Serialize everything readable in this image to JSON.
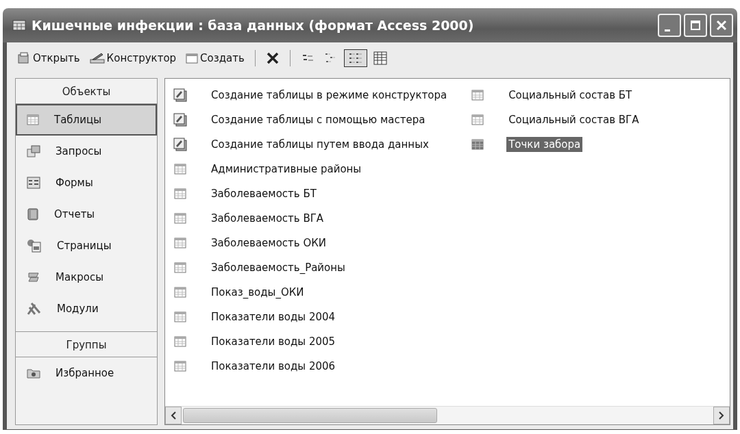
{
  "window": {
    "title": "Кишечные инфекции : база данных (формат Access 2000)"
  },
  "toolbar": [
    {
      "kind": "open",
      "label": "Открыть"
    },
    {
      "kind": "design",
      "label": "Конструктор"
    },
    {
      "kind": "new",
      "label": "Создать"
    },
    {
      "kind": "separator"
    },
    {
      "kind": "delete"
    },
    {
      "kind": "separator"
    },
    {
      "kind": "large-icons",
      "selected": false
    },
    {
      "kind": "small-icons",
      "selected": false
    },
    {
      "kind": "list",
      "selected": true
    },
    {
      "kind": "details",
      "selected": false
    }
  ],
  "sidebar": [
    {
      "header": "Объекты",
      "items": [
        {
          "kind": "table",
          "label": "Таблицы",
          "selected": true
        },
        {
          "kind": "query",
          "label": "Запросы",
          "selected": false
        },
        {
          "kind": "form",
          "label": "Формы",
          "selected": false
        },
        {
          "kind": "report",
          "label": "Отчеты",
          "selected": false
        },
        {
          "kind": "page",
          "label": "Страницы",
          "selected": false
        },
        {
          "kind": "macro",
          "label": "Макросы",
          "selected": false
        },
        {
          "kind": "module",
          "label": "Модули",
          "selected": false
        }
      ]
    },
    {
      "header": "Группы",
      "items": [
        {
          "kind": "favorites",
          "label": "Избранное",
          "selected": false
        }
      ]
    }
  ],
  "objects": [
    {
      "kind": "shortcut",
      "label": "Создание таблицы в режиме конструктора",
      "selected": false
    },
    {
      "kind": "shortcut",
      "label": "Создание таблицы с помощью мастера",
      "selected": false
    },
    {
      "kind": "shortcut",
      "label": "Создание таблицы путем ввода данных",
      "selected": false
    },
    {
      "kind": "table",
      "label": "Административные районы",
      "selected": false
    },
    {
      "kind": "table",
      "label": "Заболеваемость БТ",
      "selected": false
    },
    {
      "kind": "table",
      "label": "Заболеваемость ВГА",
      "selected": false
    },
    {
      "kind": "table",
      "label": "Заболеваемость ОКИ",
      "selected": false
    },
    {
      "kind": "table",
      "label": "Заболеваемость_Районы",
      "selected": false
    },
    {
      "kind": "table",
      "label": "Показ_воды_ОКИ",
      "selected": false
    },
    {
      "kind": "table",
      "label": "Показатели воды 2004",
      "selected": false
    },
    {
      "kind": "table",
      "label": "Показатели воды 2005",
      "selected": false
    },
    {
      "kind": "table",
      "label": "Показатели воды 2006",
      "selected": false
    },
    {
      "kind": "table",
      "label": "Социальный состав БТ",
      "selected": false
    },
    {
      "kind": "table",
      "label": "Социальный состав ВГА",
      "selected": false
    },
    {
      "kind": "table",
      "label": "Точки забора",
      "selected": true
    }
  ]
}
